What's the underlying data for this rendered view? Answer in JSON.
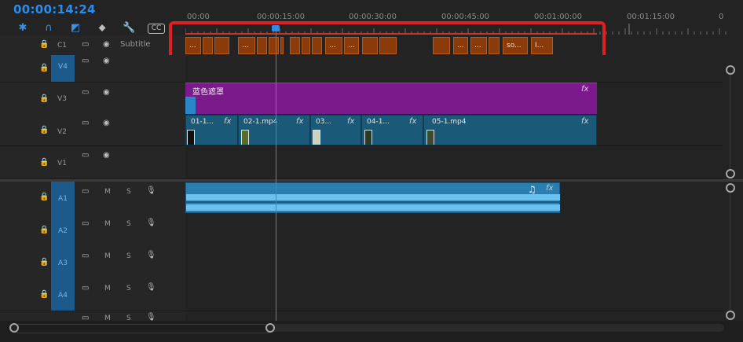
{
  "timeline": {
    "timecode": "00:00:14:24",
    "ruler_labels": [
      "00:00",
      "00:00:15:00",
      "00:00:30:00",
      "00:00:45:00",
      "00:01:00:00",
      "00:01:15:00",
      "0"
    ],
    "playhead_time": "00:00:14:24"
  },
  "toolbar": {
    "icons": [
      "snap-icon",
      "magnet-icon",
      "linked-selection-icon",
      "marker-icon",
      "wrench-icon",
      "captions-icon"
    ],
    "cc_label": "CC"
  },
  "caption_track": {
    "name": "C1",
    "label": "Subtitle",
    "clip_labels": [
      "...",
      "...",
      "...",
      "...",
      "...",
      "...",
      "...",
      "so...",
      "I..."
    ],
    "highlight_color": "#e02020"
  },
  "video_tracks": [
    {
      "name": "V4",
      "active": true
    },
    {
      "name": "V3",
      "active": false
    },
    {
      "name": "V2",
      "active": false
    },
    {
      "name": "V1",
      "active": false
    }
  ],
  "audio_tracks": [
    {
      "name": "A1",
      "active": true,
      "m": "M",
      "s": "S"
    },
    {
      "name": "A2",
      "active": true,
      "m": "M",
      "s": "S"
    },
    {
      "name": "A3",
      "active": true,
      "m": "M",
      "s": "S"
    },
    {
      "name": "A4",
      "active": true,
      "m": "M",
      "s": "S"
    }
  ],
  "clips": {
    "v3_title": "蓝色遮罩",
    "v2": [
      "01-1...",
      "02-1.mp4",
      "03...",
      "04-1...",
      "05-1.mp4"
    ],
    "fx": "fx",
    "music_icon": "♫"
  },
  "colors": {
    "accent": "#2d8ceb",
    "caption_clip": "#8b3a0a",
    "video_clip": "#1a5a78",
    "title_clip": "#7b1a8a",
    "audio_clip": "#2a7fb0",
    "audio_wave": "#6cc2ef"
  }
}
